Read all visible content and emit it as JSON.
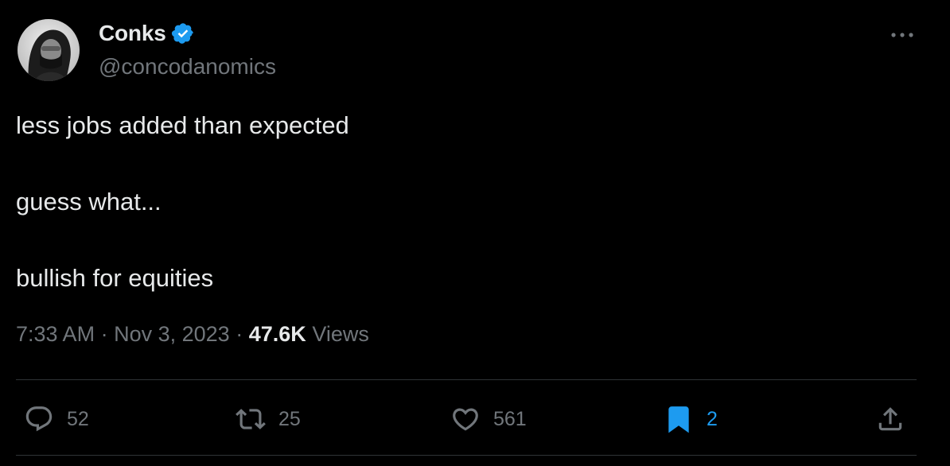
{
  "author": {
    "name": "Conks",
    "handle": "@concodanomics",
    "verified": true
  },
  "tweet": {
    "lines": [
      "less jobs added than expected",
      "guess what...",
      "bullish for equities"
    ]
  },
  "meta": {
    "time": "7:33 AM",
    "separator": "·",
    "date": "Nov 3, 2023",
    "views_count": "47.6K",
    "views_label": "Views"
  },
  "actions": {
    "replies": "52",
    "retweets": "25",
    "likes": "561",
    "bookmarks": "2"
  },
  "colors": {
    "background": "#000000",
    "text": "#e7e9ea",
    "muted": "#71767b",
    "accent": "#1d9bf0",
    "divider": "#2f3336"
  },
  "icons": [
    "verified-badge-icon",
    "more-icon",
    "reply-icon",
    "retweet-icon",
    "like-icon",
    "bookmark-icon",
    "share-icon"
  ]
}
